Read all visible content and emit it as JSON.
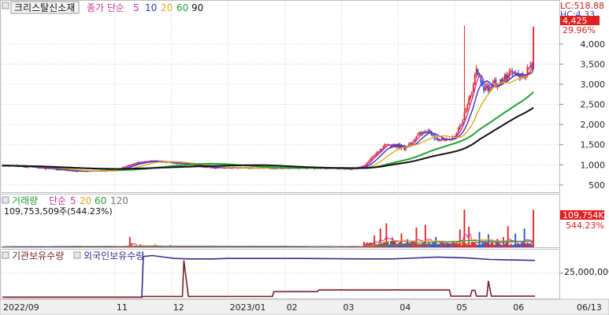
{
  "price_panel": {
    "stock_name": "크리스탈신소재",
    "ma_label": "종가 단순",
    "ma_periods": [
      {
        "label": "5",
        "color": "#cc3399"
      },
      {
        "label": "10",
        "color": "#3333cc"
      },
      {
        "label": "20",
        "color": "#e6a817"
      },
      {
        "label": "60",
        "color": "#22a033"
      },
      {
        "label": "90",
        "color": "#111111"
      }
    ],
    "lc_label": "LC:518.88",
    "hc_label": "HC:4,33",
    "current_price_label": "4,425",
    "change_pct_label": "29.96%"
  },
  "volume_panel": {
    "title": "거래량",
    "ma_label": "단순",
    "ma_periods": [
      {
        "label": "5",
        "color": "#cc3399"
      },
      {
        "label": "20",
        "color": "#e6a817"
      },
      {
        "label": "60",
        "color": "#22a033"
      },
      {
        "label": "120",
        "color": "#777777"
      }
    ],
    "volume_text": "109,753,509주(544.23%)",
    "current_volume_label": "109,754K",
    "volume_pct_label": "544.23%"
  },
  "holdings_panel": {
    "legend": [
      {
        "label": "기관보유수량",
        "color": "#7a1f2a"
      },
      {
        "label": "외국인보유수량",
        "color": "#3a2a8a"
      }
    ],
    "axis_label": "25,000,000"
  },
  "colors": {
    "up": "#e02020",
    "down": "#2050d0",
    "grid": "#cfcfcf"
  },
  "chart_data": [
    {
      "type": "candlestick",
      "title": "크리스탈신소재",
      "ylim": [
        400,
        4700
      ],
      "yticks": [
        500,
        1000,
        1500,
        2000,
        2500,
        3000,
        3500,
        4000
      ],
      "ytick_labels": [
        "500",
        "1,000",
        "1,500",
        "2,000",
        "2,500",
        "3,000",
        "3,500",
        "4,000"
      ],
      "x_labels": [
        {
          "label": "2022/09",
          "month_index": 0
        },
        {
          "label": "11",
          "month_index": 2
        },
        {
          "label": "12",
          "month_index": 3
        },
        {
          "label": "2023/01",
          "month_index": 4
        },
        {
          "label": "02",
          "month_index": 5
        },
        {
          "label": "03",
          "month_index": 6
        },
        {
          "label": "04",
          "month_index": 7
        },
        {
          "label": "05",
          "month_index": 8
        },
        {
          "label": "06",
          "month_index": 9
        },
        {
          "label": "06/13",
          "month_index": 9.42
        }
      ],
      "price_keypoints": [
        [
          0,
          980
        ],
        [
          20,
          950
        ],
        [
          50,
          840
        ],
        [
          75,
          860
        ],
        [
          88,
          1040
        ],
        [
          100,
          1100
        ],
        [
          115,
          1050
        ],
        [
          140,
          930
        ],
        [
          175,
          920
        ],
        [
          210,
          925
        ],
        [
          232,
          900
        ],
        [
          240,
          950
        ],
        [
          248,
          1220
        ],
        [
          255,
          1460
        ],
        [
          262,
          1500
        ],
        [
          268,
          1420
        ],
        [
          278,
          1750
        ],
        [
          284,
          1850
        ],
        [
          290,
          1630
        ],
        [
          298,
          1580
        ],
        [
          304,
          1850
        ],
        [
          310,
          2450
        ],
        [
          316,
          3350
        ],
        [
          322,
          2850
        ],
        [
          327,
          3000
        ],
        [
          333,
          3100
        ],
        [
          340,
          3250
        ],
        [
          345,
          3150
        ],
        [
          350,
          3300
        ],
        [
          354,
          3404
        ]
      ],
      "spikes": [
        {
          "index": 308,
          "high": 4450
        },
        {
          "index": 354,
          "high": 4420
        }
      ],
      "last_candle": {
        "open": 3404,
        "close": 4425,
        "high": 4425,
        "low": 3380
      },
      "series": [
        {
          "name": "5",
          "window": 5,
          "color": "#cc3399"
        },
        {
          "name": "10",
          "window": 10,
          "color": "#3333cc"
        },
        {
          "name": "20",
          "window": 20,
          "color": "#e6a817"
        },
        {
          "name": "60",
          "window": 60,
          "color": "#22a033"
        },
        {
          "name": "90",
          "window": 90,
          "color": "#111111"
        }
      ]
    },
    {
      "type": "bar",
      "title": "거래량",
      "ylim": [
        0,
        120000000
      ],
      "baseline_volume": 2000000,
      "events": [
        {
          "index": 85,
          "value": 30000000
        },
        {
          "index": 86,
          "value": 12000000
        },
        {
          "index": 92,
          "value": 9000000
        },
        {
          "index": 102,
          "value": 8000000
        },
        {
          "index": 112,
          "value": 6000000
        },
        {
          "index": 248,
          "value": 35000000
        },
        {
          "index": 252,
          "value": 55000000
        },
        {
          "index": 256,
          "value": 70000000
        },
        {
          "index": 260,
          "value": 28000000
        },
        {
          "index": 266,
          "value": 40000000
        },
        {
          "index": 270,
          "value": 24000000
        },
        {
          "index": 276,
          "value": 58000000
        },
        {
          "index": 282,
          "value": 66000000
        },
        {
          "index": 289,
          "value": 30000000
        },
        {
          "index": 305,
          "value": 52000000
        },
        {
          "index": 308,
          "value": 110000000
        },
        {
          "index": 311,
          "value": 60000000
        },
        {
          "index": 318,
          "value": 45000000
        },
        {
          "index": 324,
          "value": 38000000
        },
        {
          "index": 330,
          "value": 25000000
        },
        {
          "index": 334,
          "value": 30000000
        },
        {
          "index": 337,
          "value": 62000000
        },
        {
          "index": 342,
          "value": 40000000
        },
        {
          "index": 348,
          "value": 55000000
        },
        {
          "index": 354,
          "value": 109753509
        }
      ],
      "series": [
        {
          "name": "5",
          "window": 5,
          "color": "#cc3399"
        },
        {
          "name": "20",
          "window": 20,
          "color": "#e6a817"
        },
        {
          "name": "60",
          "window": 60,
          "color": "#22a033"
        },
        {
          "name": "120",
          "window": 120,
          "color": "#777777"
        }
      ]
    },
    {
      "type": "line",
      "title": "보유수량",
      "ylim": [
        0,
        45000000
      ],
      "yticks": [
        25000000
      ],
      "ytick_labels": [
        "25,000,000"
      ],
      "series": [
        {
          "name": "외국인보유수량",
          "color": "#3a2a8a",
          "points": [
            [
              0,
              600000
            ],
            [
              93,
              600000
            ],
            [
              94,
              42000000
            ],
            [
              100,
              43000000
            ],
            [
              110,
              41000000
            ],
            [
              115,
              40000000
            ],
            [
              125,
              39500000
            ],
            [
              140,
              39500000
            ],
            [
              150,
              40000000
            ],
            [
              200,
              40000000
            ],
            [
              240,
              39500000
            ],
            [
              260,
              39500000
            ],
            [
              290,
              41500000
            ],
            [
              310,
              40500000
            ],
            [
              325,
              39000000
            ],
            [
              340,
              38500000
            ],
            [
              355,
              38000000
            ]
          ]
        },
        {
          "name": "기관보유수량",
          "color": "#7a1f2a",
          "points": [
            [
              0,
              600000
            ],
            [
              93,
              600000
            ],
            [
              94,
              1300000
            ],
            [
              120,
              1300000
            ],
            [
              121,
              38000000
            ],
            [
              124,
              1300000
            ],
            [
              180,
              1300000
            ],
            [
              181,
              6200000
            ],
            [
              210,
              6200000
            ],
            [
              211,
              7900000
            ],
            [
              298,
              7900000
            ],
            [
              299,
              1500000
            ],
            [
              312,
              1500000
            ],
            [
              313,
              7500000
            ],
            [
              315,
              7500000
            ],
            [
              316,
              1500000
            ],
            [
              323,
              1500000
            ],
            [
              324,
              17000000
            ],
            [
              326,
              1500000
            ],
            [
              355,
              1500000
            ]
          ]
        }
      ]
    }
  ]
}
